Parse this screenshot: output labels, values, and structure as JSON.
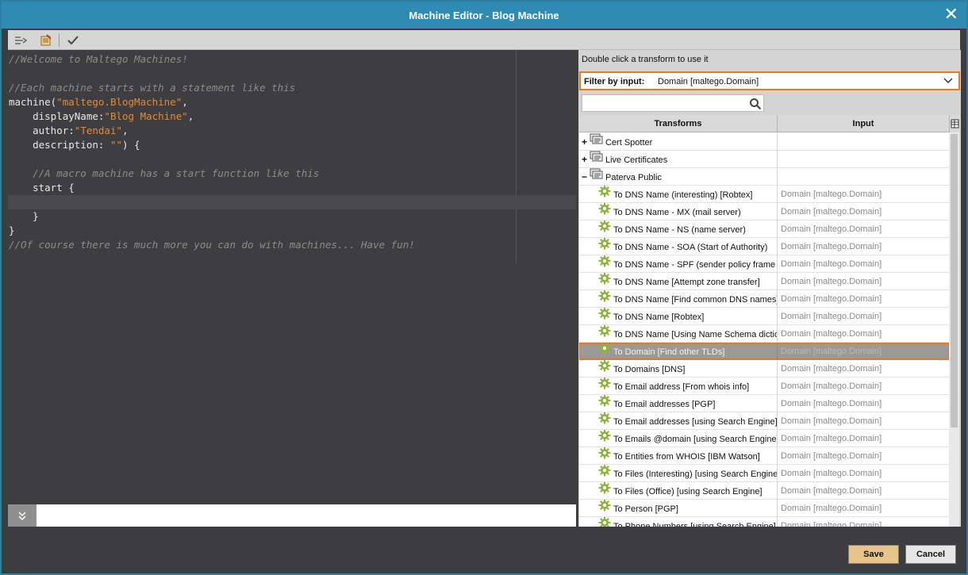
{
  "window": {
    "title": "Machine Editor - Blog Machine",
    "close_symbol": "✕"
  },
  "toolbar": {
    "buttons": [
      {
        "name": "run-machine-icon"
      },
      {
        "name": "edit-icon"
      },
      {
        "name": "validate-check-icon"
      }
    ]
  },
  "editor": {
    "lines": [
      {
        "parts": [
          {
            "t": "cmt",
            "v": "//Welcome to Maltego Machines!"
          }
        ]
      },
      {
        "parts": []
      },
      {
        "parts": [
          {
            "t": "cmt",
            "v": "//Each machine starts with a statement like this"
          }
        ]
      },
      {
        "parts": [
          {
            "t": "kw",
            "v": "machine("
          },
          {
            "t": "str",
            "v": "\"maltego.BlogMachine\""
          },
          {
            "t": "kw",
            "v": ","
          }
        ]
      },
      {
        "parts": [
          {
            "t": "kw",
            "v": "    displayName:"
          },
          {
            "t": "str",
            "v": "\"Blog Machine\""
          },
          {
            "t": "kw",
            "v": ","
          }
        ]
      },
      {
        "parts": [
          {
            "t": "kw",
            "v": "    author:"
          },
          {
            "t": "str",
            "v": "\"Tendai\""
          },
          {
            "t": "kw",
            "v": ","
          }
        ]
      },
      {
        "parts": [
          {
            "t": "kw",
            "v": "    description: "
          },
          {
            "t": "str",
            "v": "\"\""
          },
          {
            "t": "kw",
            "v": ") {"
          }
        ]
      },
      {
        "parts": []
      },
      {
        "parts": [
          {
            "t": "cmt",
            "v": "    //A macro machine has a start function like this"
          }
        ]
      },
      {
        "parts": [
          {
            "t": "kw",
            "v": "    start {"
          }
        ]
      },
      {
        "parts": [],
        "current": true
      },
      {
        "parts": [
          {
            "t": "kw",
            "v": "    }"
          }
        ]
      },
      {
        "parts": [
          {
            "t": "kw",
            "v": "}"
          }
        ]
      },
      {
        "parts": [
          {
            "t": "cmt",
            "v": "//Of course there is much more you can do with machines... Have fun!"
          }
        ]
      }
    ]
  },
  "panel": {
    "hint": "Double click a transform to use it",
    "filter_label": "Filter by input:",
    "filter_value": "Domain [maltego.Domain]",
    "search_placeholder": "",
    "columns": {
      "transforms": "Transforms",
      "input": "Input"
    }
  },
  "rows": [
    {
      "kind": "group",
      "expander": "+",
      "label": "Cert Spotter",
      "input": ""
    },
    {
      "kind": "group",
      "expander": "+",
      "label": "Live Certificates",
      "input": ""
    },
    {
      "kind": "group",
      "expander": "−",
      "label": "Paterva Public",
      "input": ""
    },
    {
      "kind": "item",
      "label": "To DNS Name (interesting) [Robtex]",
      "input": "Domain [maltego.Domain]"
    },
    {
      "kind": "item",
      "label": "To DNS Name - MX (mail server)",
      "input": "Domain [maltego.Domain]"
    },
    {
      "kind": "item",
      "label": "To DNS Name - NS (name server)",
      "input": "Domain [maltego.Domain]"
    },
    {
      "kind": "item",
      "label": "To DNS Name - SOA (Start of Authority)",
      "input": "Domain [maltego.Domain]"
    },
    {
      "kind": "item",
      "label": "To DNS Name - SPF (sender policy frame",
      "input": "Domain [maltego.Domain]"
    },
    {
      "kind": "item",
      "label": "To DNS Name [Attempt zone transfer]",
      "input": "Domain [maltego.Domain]"
    },
    {
      "kind": "item",
      "label": "To DNS Name [Find common DNS names]",
      "input": "Domain [maltego.Domain]"
    },
    {
      "kind": "item",
      "label": "To DNS Name [Robtex]",
      "input": "Domain [maltego.Domain]"
    },
    {
      "kind": "item",
      "label": "To DNS Name [Using Name Schema dictio",
      "input": "Domain [maltego.Domain]"
    },
    {
      "kind": "item",
      "label": "To Domain [Find other TLDs]",
      "input": "Domain [maltego.Domain]",
      "selected": true
    },
    {
      "kind": "item",
      "label": "To Domains [DNS]",
      "input": "Domain [maltego.Domain]"
    },
    {
      "kind": "item",
      "label": "To Email address [From whois info]",
      "input": "Domain [maltego.Domain]"
    },
    {
      "kind": "item",
      "label": "To Email addresses [PGP]",
      "input": "Domain [maltego.Domain]"
    },
    {
      "kind": "item",
      "label": "To Email addresses [using Search Engine]",
      "input": "Domain [maltego.Domain]"
    },
    {
      "kind": "item",
      "label": "To Emails @domain [using Search Engine]",
      "input": "Domain [maltego.Domain]"
    },
    {
      "kind": "item",
      "label": "To Entities from WHOIS [IBM Watson]",
      "input": "Domain [maltego.Domain]"
    },
    {
      "kind": "item",
      "label": "To Files (Interesting) [using Search Engine",
      "input": "Domain [maltego.Domain]"
    },
    {
      "kind": "item",
      "label": "To Files (Office) [using Search Engine]",
      "input": "Domain [maltego.Domain]"
    },
    {
      "kind": "item",
      "label": "To Person [PGP]",
      "input": "Domain [maltego.Domain]"
    },
    {
      "kind": "item",
      "label": "To Phone Numbers [using Search Engine]",
      "input": "Domain [maltego.Domain]"
    }
  ],
  "buttons": {
    "save": "Save",
    "cancel": "Cancel"
  },
  "colors": {
    "accent": "#2f8bb1",
    "highlight": "#e47b1e",
    "gear": "#8bb43a",
    "save_bg": "#e6c48a"
  }
}
